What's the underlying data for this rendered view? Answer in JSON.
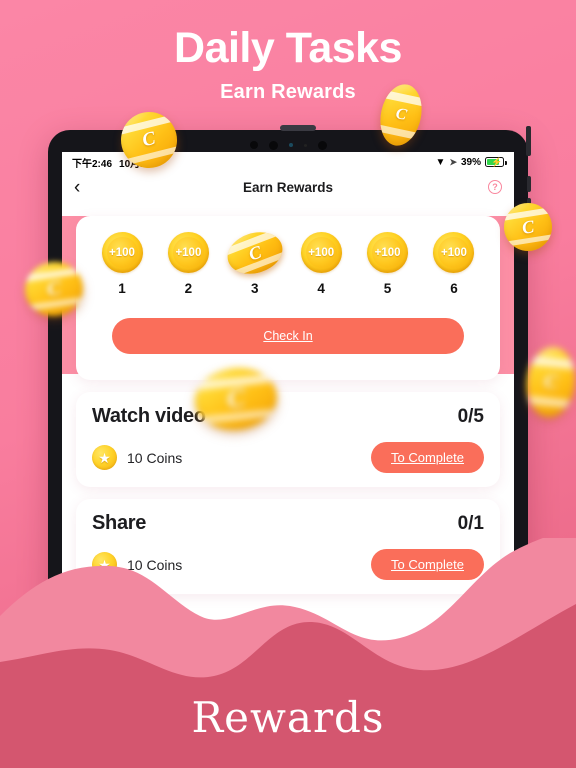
{
  "promo": {
    "title": "Daily Tasks",
    "subtitle": "Earn Rewards",
    "wordmark": "Rewards"
  },
  "colors": {
    "background_pink": "#F97D9E",
    "app_band_pink": "#FC8FA5",
    "accent_coral": "#FA6E5A",
    "coin_gold": "#FFD324",
    "wave_light": "#F2889F",
    "wave_dark": "#D4566F",
    "battery_green": "#32D74B"
  },
  "device": {
    "statusbar": {
      "time": "下午2:46",
      "date": "10月1",
      "wifi_icon": "wifi-icon",
      "location_icon": "location-arrow-icon",
      "battery_percent": "39%",
      "battery_charging_icon": "lightning-bolt-icon"
    }
  },
  "navbar": {
    "back_icon": "chevron-left-icon",
    "title": "Earn Rewards",
    "help_icon": "question-mark-icon",
    "help_label": "?"
  },
  "checkin": {
    "days": [
      {
        "day": "1",
        "reward": "+100",
        "active": false
      },
      {
        "day": "2",
        "reward": "+100",
        "active": false
      },
      {
        "day": "3",
        "reward": "C",
        "active": true
      },
      {
        "day": "4",
        "reward": "+100",
        "active": false
      },
      {
        "day": "5",
        "reward": "+100",
        "active": false
      },
      {
        "day": "6",
        "reward": "+100",
        "active": false
      }
    ],
    "button_label": "Check In"
  },
  "tasks": [
    {
      "title": "Watch video",
      "count": "0/5",
      "reward_icon": "star-coin-icon",
      "reward_label": "10 Coins",
      "action_label": "To Complete"
    },
    {
      "title": "Share",
      "count": "0/1",
      "reward_icon": "star-coin-icon",
      "reward_label": "10 Coins",
      "action_label": "To Complete"
    }
  ],
  "floating_coins": [
    {
      "name": "coin-top-left",
      "glyph": "C"
    },
    {
      "name": "coin-top-right",
      "glyph": "C"
    },
    {
      "name": "coin-mid-left",
      "glyph": "C"
    },
    {
      "name": "coin-mid-right",
      "glyph": "C"
    },
    {
      "name": "coin-center",
      "glyph": "C"
    },
    {
      "name": "coin-lower-right",
      "glyph": "C"
    },
    {
      "name": "coin-bottom-right",
      "glyph": "C"
    }
  ]
}
